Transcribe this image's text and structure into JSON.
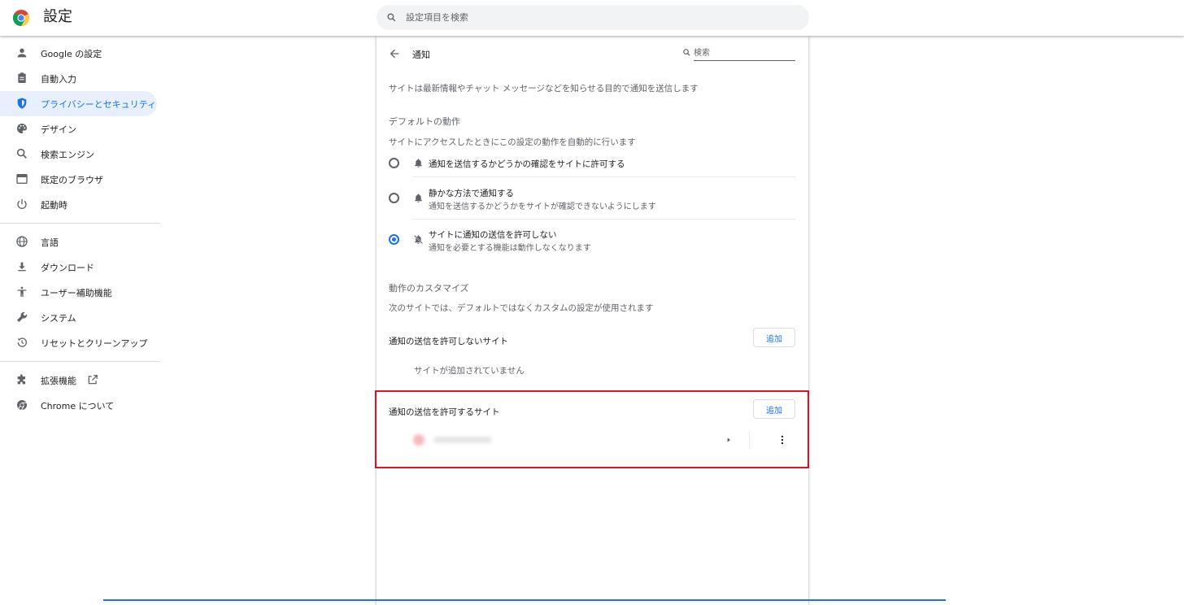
{
  "app": {
    "title": "設定"
  },
  "search": {
    "placeholder": "設定項目を検索"
  },
  "sidebar": {
    "items": [
      {
        "label": "Google の設定",
        "icon": "person-icon"
      },
      {
        "label": "自動入力",
        "icon": "clipboard-icon"
      },
      {
        "label": "プライバシーとセキュリティ",
        "icon": "shield-icon",
        "active": true
      },
      {
        "label": "デザイン",
        "icon": "palette-icon"
      },
      {
        "label": "検索エンジン",
        "icon": "search-icon"
      },
      {
        "label": "既定のブラウザ",
        "icon": "browser-icon"
      },
      {
        "label": "起動時",
        "icon": "power-icon"
      },
      {
        "label": "言語",
        "icon": "globe-icon"
      },
      {
        "label": "ダウンロード",
        "icon": "download-icon"
      },
      {
        "label": "ユーザー補助機能",
        "icon": "accessibility-icon"
      },
      {
        "label": "システム",
        "icon": "wrench-icon"
      },
      {
        "label": "リセットとクリーンアップ",
        "icon": "restore-icon"
      },
      {
        "label": "拡張機能",
        "icon": "puzzle-icon"
      },
      {
        "label": "Chrome について",
        "icon": "chrome-icon"
      }
    ]
  },
  "panel": {
    "title": "通知",
    "search_placeholder": "検索",
    "description": "サイトは最新情報やチャット メッセージなどを知らせる目的で通知を送信します",
    "default_heading": "デフォルトの動作",
    "default_desc": "サイトにアクセスしたときにこの設定の動作を自動的に行います",
    "options": [
      {
        "label": "通知を送信するかどうかの確認をサイトに許可する",
        "sublabel": "",
        "icon": "bell-icon",
        "selected": false
      },
      {
        "label": "静かな方法で通知する",
        "sublabel": "通知を送信するかどうかをサイトが確認できないようにします",
        "icon": "bell-icon",
        "selected": false
      },
      {
        "label": "サイトに通知の送信を許可しない",
        "sublabel": "通知を必要とする機能は動作しなくなります",
        "icon": "bell-off-icon",
        "selected": true
      }
    ],
    "custom_heading": "動作のカスタマイズ",
    "custom_desc": "次のサイトでは、デフォルトではなくカスタムの設定が使用されます",
    "blocked": {
      "heading": "通知の送信を許可しないサイト",
      "add_label": "追加",
      "empty": "サイトが追加されていません"
    },
    "allowed": {
      "heading": "通知の送信を許可するサイト",
      "add_label": "追加"
    }
  },
  "colors": {
    "accent": "#1a73e8",
    "highlight": "#e0121f"
  }
}
